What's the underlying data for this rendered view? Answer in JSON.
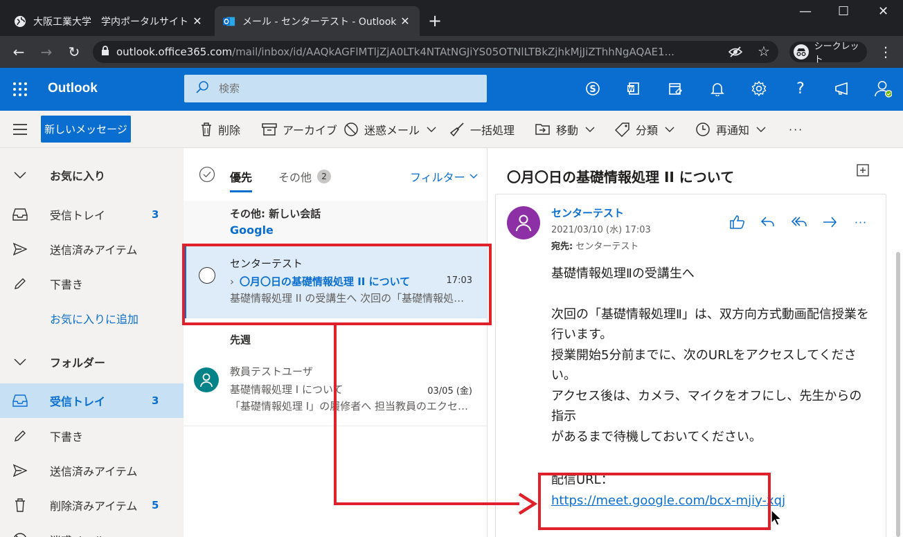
{
  "browser": {
    "tabs": [
      {
        "title": "大阪工業大学　学内ポータルサイト",
        "active": false
      },
      {
        "title": "メール - センターテスト - Outlook",
        "active": true
      }
    ],
    "url_host": "outlook.office365.com",
    "url_path": "/mail/inbox/id/AAQkAGFlMTljZjA0LTk4NTAtNGJiYS05OTNlLTBkZjhkMjJiZThhNgAQAE1...",
    "incognito_label": "シークレット"
  },
  "header": {
    "app_name": "Outlook",
    "search_placeholder": "検索"
  },
  "toolbar": {
    "new_message": "新しいメッセージ",
    "commands": [
      "削除",
      "アーカイブ",
      "迷惑メール",
      "一括処理",
      "移動",
      "分類",
      "再通知"
    ],
    "more": "···"
  },
  "nav": {
    "favorites_header": "お気に入り",
    "favorites": [
      {
        "label": "受信トレイ",
        "count": "3"
      },
      {
        "label": "送信済みアイテム",
        "count": ""
      },
      {
        "label": "下書き",
        "count": ""
      }
    ],
    "add_favorite": "お気に入りに追加",
    "folders_header": "フォルダー",
    "folders": [
      {
        "label": "受信トレイ",
        "count": "3"
      },
      {
        "label": "下書き",
        "count": ""
      },
      {
        "label": "送信済みアイテム",
        "count": ""
      },
      {
        "label": "削除済みアイテム",
        "count": "5"
      },
      {
        "label": "迷惑メール",
        "count": ""
      }
    ]
  },
  "list": {
    "pivot_focused": "優先",
    "pivot_other": "その他",
    "pivot_other_count": "2",
    "filter": "フィルター",
    "other_conv_title": "その他: 新しい会話",
    "other_conv_sender": "Google",
    "messages": [
      {
        "sender": "センターテスト",
        "subject": "〇月〇日の基礎情報処理 II について",
        "time": "17:03",
        "preview": "基礎情報処理 II の受講生へ 次回の「基礎情報処理 II」は、双方向方式動画配信"
      },
      {
        "sender": "教員テストユーザ",
        "subject": "基礎情報処理 I について",
        "time": "03/05 (金)",
        "preview": "「基礎情報処理 I」の履修者へ 担当教員のエクセルファイル"
      }
    ],
    "group_last_week": "先週"
  },
  "reading": {
    "subject": "〇月〇日の基礎情報処理 II について",
    "from": "センターテスト",
    "date": "2021/03/10 (水) 17:03",
    "to_label": "宛先:",
    "to": "センターテスト",
    "body": [
      "基礎情報処理Ⅱの受講生へ",
      "",
      "次回の「基礎情報処理Ⅱ」は、双方向方式動画配信授業を",
      "行います。",
      "授業開始5分前までに、次のURLをアクセスしてください。",
      "アクセス後は、カメラ、マイクをオフにし、先生からの指示",
      "があるまで待機しておいてください。",
      ""
    ],
    "url_label": "配信URL：",
    "url": "https://meet.google.com/bcx-mjiy-xqj"
  },
  "colors": {
    "accent": "#0a6ed1",
    "annotation": "#e0212b",
    "avatar_center": "#8d2fa5",
    "avatar_teacher": "#038387"
  }
}
